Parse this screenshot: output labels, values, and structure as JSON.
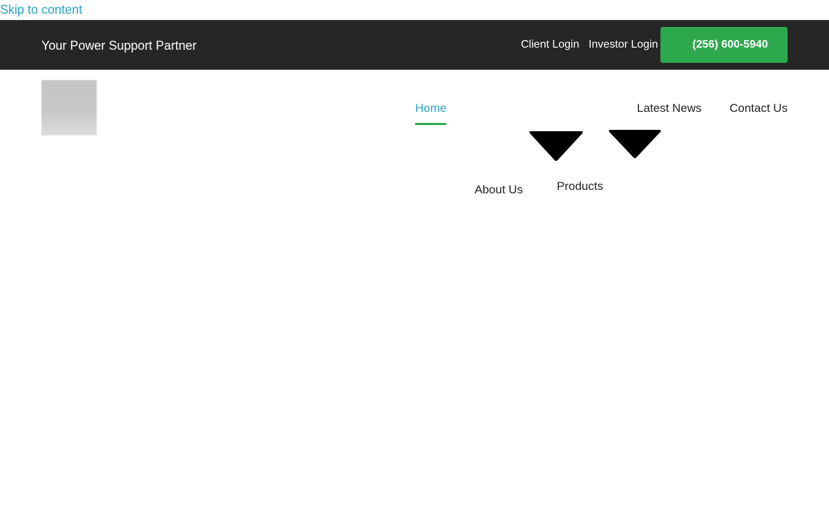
{
  "skip_link": "Skip to content",
  "topbar": {
    "tagline": "Your Power Support Partner",
    "client_login": "Client Login",
    "investor_login": "Investor Login",
    "phone": "(256) 600-5940"
  },
  "nav": {
    "home": "Home",
    "latest_news": "Latest News",
    "contact_us": "Contact Us",
    "about_us": "About Us",
    "products": "Products"
  },
  "icons": {
    "dropdown_1": "chevron-down-icon",
    "dropdown_2": "chevron-down-icon"
  },
  "colors": {
    "topbar_background": "#262626",
    "phone_button": "#2ea84c",
    "active_link": "#2aa3c4",
    "active_underline": "#2ea84c"
  }
}
